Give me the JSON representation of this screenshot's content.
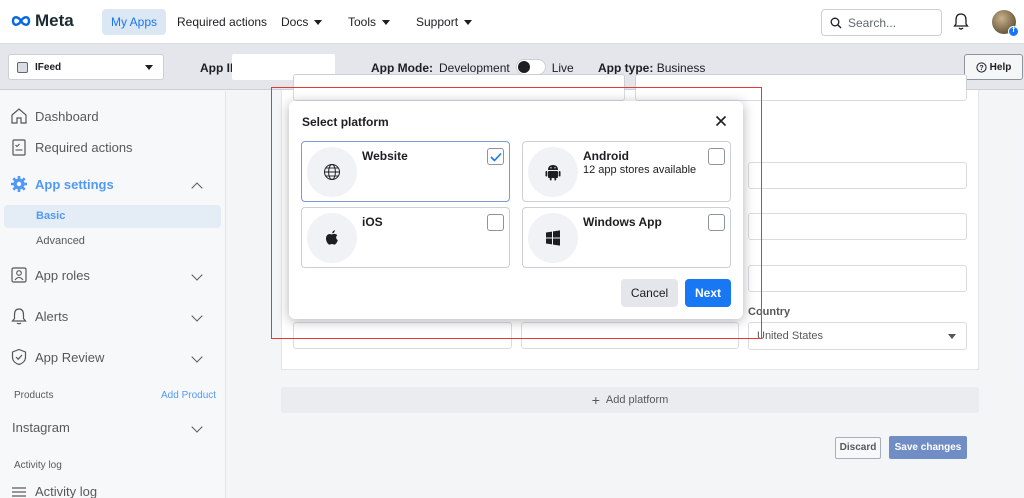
{
  "nav": {
    "logo_text": "Meta",
    "links": [
      {
        "label": "My Apps"
      },
      {
        "label": "Required actions"
      },
      {
        "label": "Docs"
      },
      {
        "label": "Tools"
      },
      {
        "label": "Support"
      }
    ],
    "search_placeholder": "Search..."
  },
  "subbar": {
    "app_name": "IFeed",
    "app_id_label": "App ID",
    "app_mode_label": "App Mode:",
    "app_mode_value": "Development",
    "live_label": "Live",
    "app_type_label": "App type:",
    "app_type_value": "Business",
    "help_label": "Help"
  },
  "sidebar": {
    "dashboard": "Dashboard",
    "required_actions": "Required actions",
    "app_settings": "App settings",
    "basic": "Basic",
    "advanced": "Advanced",
    "app_roles": "App roles",
    "alerts": "Alerts",
    "app_review": "App Review",
    "products": "Products",
    "add_product": "Add Product",
    "instagram": "Instagram",
    "activity_log_section": "Activity log",
    "activity_log_item": "Activity log"
  },
  "main": {
    "country_label": "Country",
    "country_value": "United States",
    "add_platform": "Add platform",
    "discard": "Discard",
    "save_changes": "Save changes"
  },
  "modal": {
    "title": "Select platform",
    "platforms": [
      {
        "name": "Website",
        "subtitle": "",
        "checked": true,
        "icon": "globe-icon"
      },
      {
        "name": "Android",
        "subtitle": "12 app stores available",
        "checked": false,
        "icon": "android-icon"
      },
      {
        "name": "iOS",
        "subtitle": "",
        "checked": false,
        "icon": "apple-icon"
      },
      {
        "name": "Windows App",
        "subtitle": "",
        "checked": false,
        "icon": "windows-icon"
      }
    ],
    "cancel": "Cancel",
    "next": "Next"
  },
  "colors": {
    "accent": "#1877f2",
    "highlight_border": "#e53935",
    "save_button": "#4267b2"
  }
}
